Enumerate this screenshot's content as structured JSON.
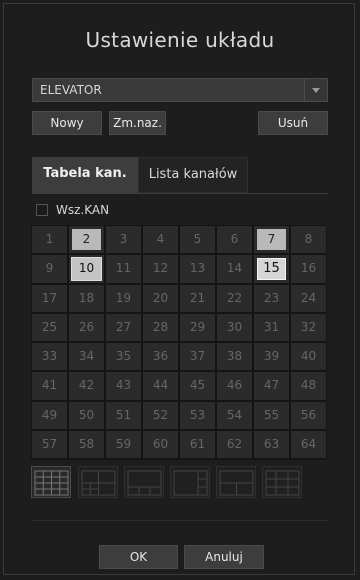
{
  "dialog": {
    "title": "Ustawienie układu"
  },
  "layout_select": {
    "value": "ELEVATOR"
  },
  "actions": {
    "new_label": "Nowy",
    "rename_label": "Zm.naz.",
    "delete_label": "Usuń"
  },
  "tabs": [
    {
      "label": "Tabela kan.",
      "active": true
    },
    {
      "label": "Lista kanałów",
      "active": false
    }
  ],
  "all_channels": {
    "label": "Wsz.KAN",
    "checked": false
  },
  "channels": [
    "1",
    "2",
    "3",
    "4",
    "5",
    "6",
    "7",
    "8",
    "9",
    "10",
    "11",
    "12",
    "13",
    "14",
    "15",
    "16",
    "17",
    "18",
    "19",
    "20",
    "21",
    "22",
    "23",
    "24",
    "25",
    "26",
    "27",
    "28",
    "29",
    "30",
    "31",
    "32",
    "33",
    "34",
    "35",
    "36",
    "37",
    "38",
    "39",
    "40",
    "41",
    "42",
    "43",
    "44",
    "45",
    "46",
    "47",
    "48",
    "49",
    "50",
    "51",
    "52",
    "53",
    "54",
    "55",
    "56",
    "57",
    "58",
    "59",
    "60",
    "61",
    "62",
    "63",
    "64"
  ],
  "selected_channels": [
    "2",
    "7",
    "10",
    "15"
  ],
  "layout_icons": [
    "grid-16-icon",
    "grid-split-a-icon",
    "grid-split-b-icon",
    "grid-split-c-icon",
    "grid-split-d-icon",
    "grid-split-e-icon"
  ],
  "footer": {
    "ok_label": "OK",
    "cancel_label": "Anuluj"
  }
}
